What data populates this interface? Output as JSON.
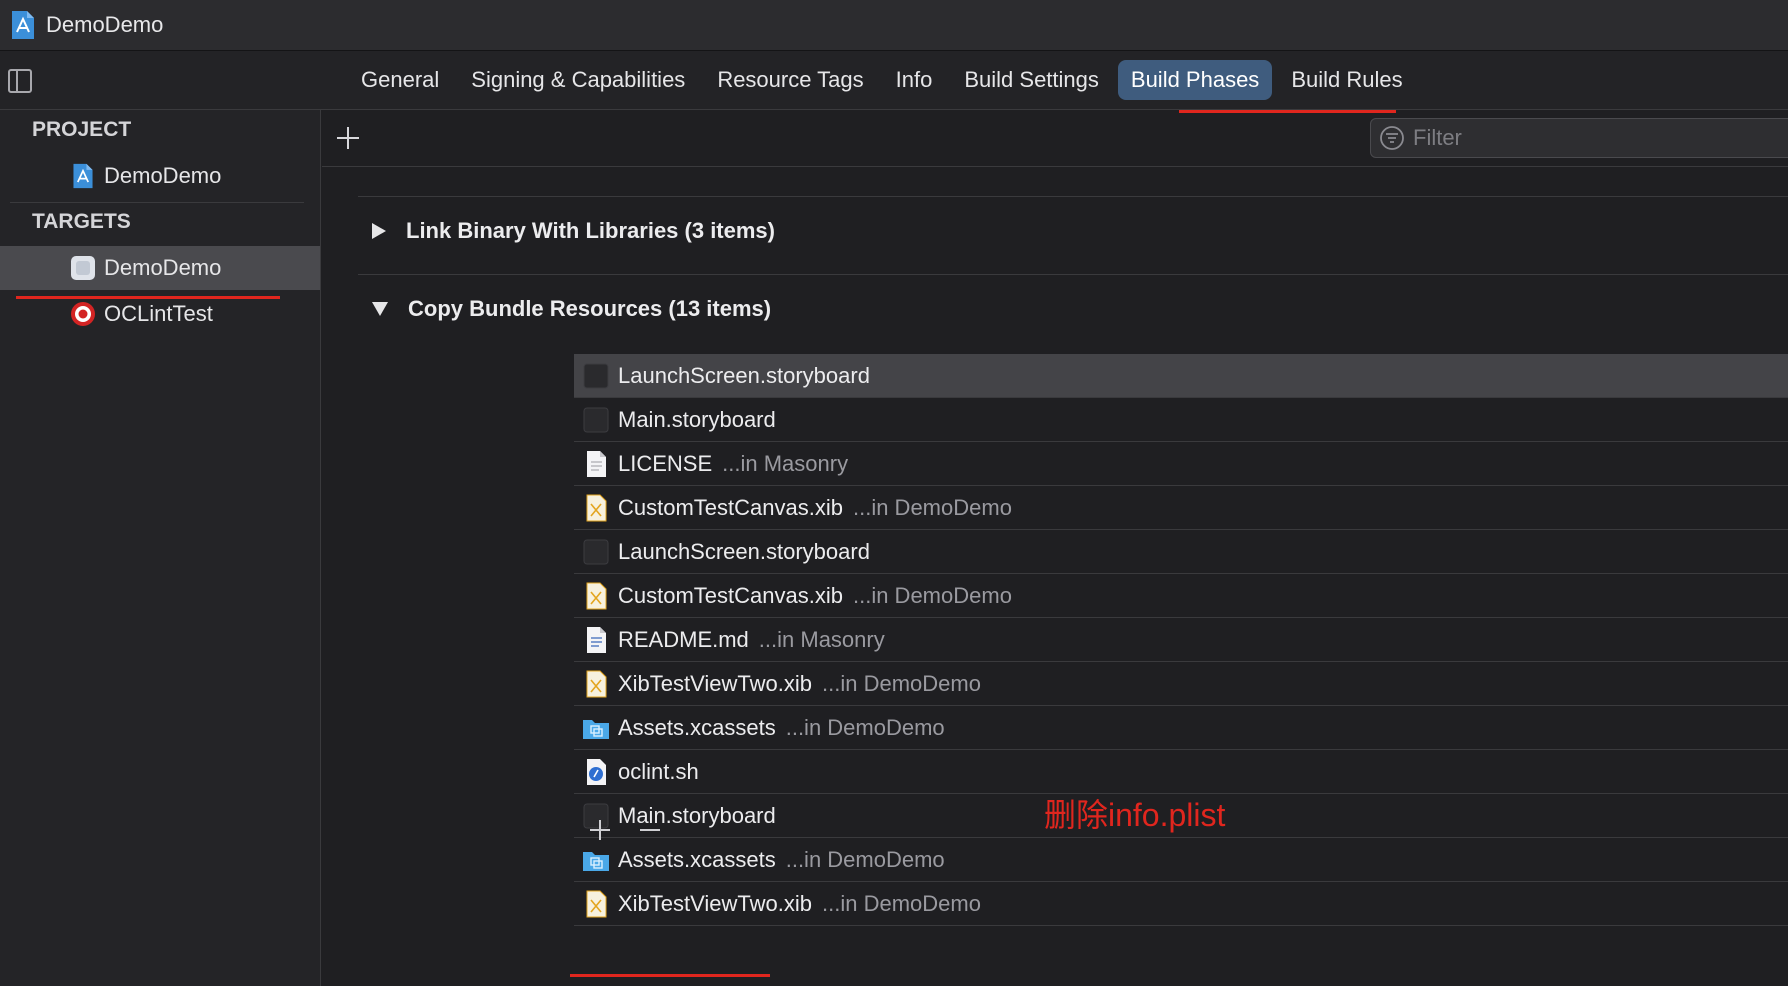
{
  "window": {
    "title": "DemoDemo"
  },
  "tabs": [
    {
      "label": "General"
    },
    {
      "label": "Signing & Capabilities"
    },
    {
      "label": "Resource Tags"
    },
    {
      "label": "Info"
    },
    {
      "label": "Build Settings"
    },
    {
      "label": "Build Phases",
      "active": true
    },
    {
      "label": "Build Rules"
    }
  ],
  "sidebar": {
    "project_header": "PROJECT",
    "project_items": [
      {
        "label": "DemoDemo",
        "icon": "xcode-project-icon"
      }
    ],
    "targets_header": "TARGETS",
    "target_items": [
      {
        "label": "DemoDemo",
        "icon": "app-target-icon",
        "selected": true
      },
      {
        "label": "OCLintTest",
        "icon": "aggregate-target-icon"
      }
    ]
  },
  "filter": {
    "placeholder": "Filter"
  },
  "phases": {
    "link": {
      "label": "Link Binary With Libraries (3 items)",
      "expanded": false
    },
    "copy": {
      "label": "Copy Bundle Resources (13 items)",
      "expanded": true
    }
  },
  "resources": [
    {
      "name": "LaunchScreen.storyboard",
      "location": "",
      "icon": "storyboard-icon"
    },
    {
      "name": "Main.storyboard",
      "location": "",
      "icon": "storyboard-icon"
    },
    {
      "name": "LICENSE",
      "location": "...in Masonry",
      "icon": "document-icon"
    },
    {
      "name": "CustomTestCanvas.xib",
      "location": "...in DemoDemo",
      "icon": "xib-icon"
    },
    {
      "name": "LaunchScreen.storyboard",
      "location": "",
      "icon": "storyboard-icon"
    },
    {
      "name": "CustomTestCanvas.xib",
      "location": "...in DemoDemo",
      "icon": "xib-icon"
    },
    {
      "name": "README.md",
      "location": "...in Masonry",
      "icon": "markdown-icon"
    },
    {
      "name": "XibTestViewTwo.xib",
      "location": "...in DemoDemo",
      "icon": "xib-icon"
    },
    {
      "name": "Assets.xcassets",
      "location": "...in DemoDemo",
      "icon": "asset-catalog-icon"
    },
    {
      "name": "oclint.sh",
      "location": "",
      "icon": "shell-script-icon"
    },
    {
      "name": "Main.storyboard",
      "location": "",
      "icon": "storyboard-icon"
    },
    {
      "name": "Assets.xcassets",
      "location": "...in DemoDemo",
      "icon": "asset-catalog-icon"
    },
    {
      "name": "XibTestViewTwo.xib",
      "location": "...in DemoDemo",
      "icon": "xib-icon"
    }
  ],
  "annotation": {
    "text": "删除info.plist"
  },
  "colors": {
    "accent": "#3f5c7e",
    "annotation_red": "#e0261e",
    "background": "#1f1f22"
  }
}
